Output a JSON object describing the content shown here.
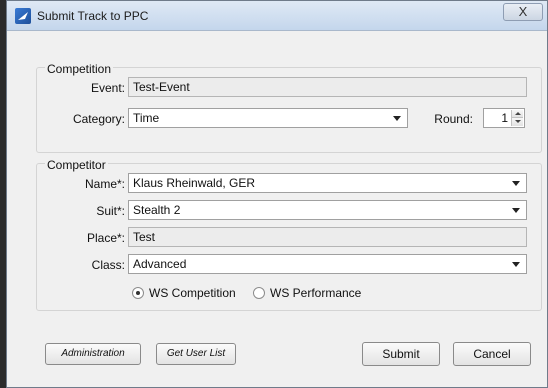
{
  "window": {
    "title": "Submit Track to PPC",
    "close_symbol": "X"
  },
  "competition": {
    "group_title": "Competition",
    "event_label": "Event:",
    "event_value": "Test-Event",
    "category_label": "Category:",
    "category_value": "Time",
    "round_label": "Round:",
    "round_value": "1"
  },
  "competitor": {
    "group_title": "Competitor",
    "name_label": "Name*:",
    "name_value": "Klaus Rheinwald, GER",
    "suit_label": "Suit*:",
    "suit_value": "Stealth 2",
    "place_label": "Place*:",
    "place_value": "Test",
    "class_label": "Class:",
    "class_value": "Advanced",
    "radio_competition": "WS Competition",
    "radio_performance": "WS Performance",
    "selected_radio": "WS Competition"
  },
  "buttons": {
    "administration": "Administration",
    "get_user_list": "Get User List",
    "submit": "Submit",
    "cancel": "Cancel"
  }
}
